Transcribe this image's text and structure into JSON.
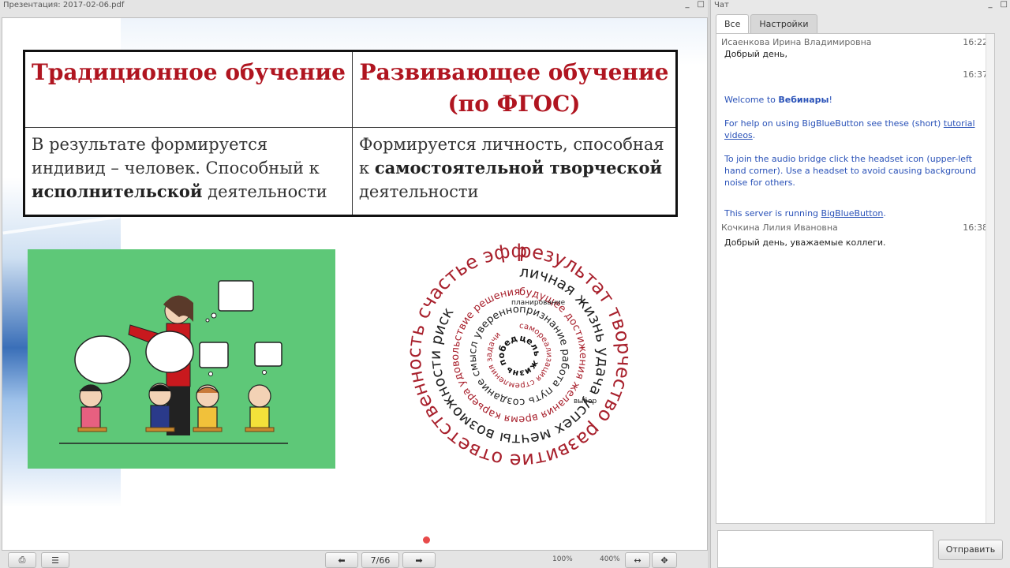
{
  "presentation": {
    "window_title": "Презентация: 2017-02-06.pdf",
    "window_buttons": [
      "_",
      "□"
    ],
    "slide": {
      "header_left": "Традиционное  обучение",
      "header_right_1": "Развивающее обучение",
      "header_right_2": "(по ФГОС)",
      "cell_left_a": "В результате формируется индивид – человек. Способный к ",
      "cell_left_bold": "исполнительской",
      "cell_left_b": " деятельности",
      "cell_right_a": "Формируется личность, способная к ",
      "cell_right_bold": "самостоятельной творческой",
      "cell_right_b": " деятельности",
      "word_cloud": {
        "outer": "результат творчество развитие ответственность счастье эффективность",
        "ring2": "личная жизнь удача успех мечты возможности риск",
        "ring3": "будущее достижения желания время карьера удовольствие решения любовь",
        "ring4": "признание работа путь создание смысл уверенность",
        "ring5": "самореализация стремления задачи",
        "inner": "цель жизнь победа",
        "word_planning": "планирование",
        "word_choice": "выбор"
      }
    },
    "toolbar": {
      "page_indicator": "7/66",
      "zoom_min": "100%",
      "zoom_max": "400%"
    }
  },
  "chat": {
    "window_title": "Чат",
    "tabs": [
      "Все",
      "Настройки"
    ],
    "messages": [
      {
        "author": "Исаенкова Ирина Владимировна",
        "time": "16:22",
        "text": "Добрый день,"
      },
      {
        "time": "16:37"
      }
    ],
    "welcome": {
      "line1_a": "Welcome to ",
      "line1_bold": "Вебинары",
      "line1_b": "!",
      "line2_a": "For help on using BigBlueButton see these (short) ",
      "line2_link": "tutorial videos",
      "line2_b": ".",
      "line3": "To join the audio bridge click the headset icon (upper-left hand corner).  Use a headset to avoid causing background noise for others.",
      "line4_a": "This server is running ",
      "line4_link": "BigBlueButton",
      "line4_b": "."
    },
    "messages2": [
      {
        "author": "Кочкина Лилия Ивановна",
        "time": "16:38",
        "text": "Добрый день, уважаемые коллеги."
      }
    ],
    "send_label": "Отправить"
  }
}
